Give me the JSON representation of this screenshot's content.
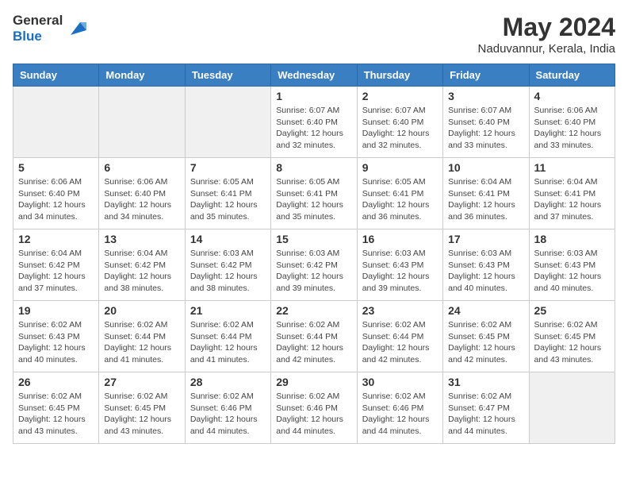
{
  "header": {
    "logo_line1": "General",
    "logo_line2": "Blue",
    "month_year": "May 2024",
    "location": "Naduvannur, Kerala, India"
  },
  "weekdays": [
    "Sunday",
    "Monday",
    "Tuesday",
    "Wednesday",
    "Thursday",
    "Friday",
    "Saturday"
  ],
  "weeks": [
    [
      {
        "day": "",
        "info": ""
      },
      {
        "day": "",
        "info": ""
      },
      {
        "day": "",
        "info": ""
      },
      {
        "day": "1",
        "info": "Sunrise: 6:07 AM\nSunset: 6:40 PM\nDaylight: 12 hours\nand 32 minutes."
      },
      {
        "day": "2",
        "info": "Sunrise: 6:07 AM\nSunset: 6:40 PM\nDaylight: 12 hours\nand 32 minutes."
      },
      {
        "day": "3",
        "info": "Sunrise: 6:07 AM\nSunset: 6:40 PM\nDaylight: 12 hours\nand 33 minutes."
      },
      {
        "day": "4",
        "info": "Sunrise: 6:06 AM\nSunset: 6:40 PM\nDaylight: 12 hours\nand 33 minutes."
      }
    ],
    [
      {
        "day": "5",
        "info": "Sunrise: 6:06 AM\nSunset: 6:40 PM\nDaylight: 12 hours\nand 34 minutes."
      },
      {
        "day": "6",
        "info": "Sunrise: 6:06 AM\nSunset: 6:40 PM\nDaylight: 12 hours\nand 34 minutes."
      },
      {
        "day": "7",
        "info": "Sunrise: 6:05 AM\nSunset: 6:41 PM\nDaylight: 12 hours\nand 35 minutes."
      },
      {
        "day": "8",
        "info": "Sunrise: 6:05 AM\nSunset: 6:41 PM\nDaylight: 12 hours\nand 35 minutes."
      },
      {
        "day": "9",
        "info": "Sunrise: 6:05 AM\nSunset: 6:41 PM\nDaylight: 12 hours\nand 36 minutes."
      },
      {
        "day": "10",
        "info": "Sunrise: 6:04 AM\nSunset: 6:41 PM\nDaylight: 12 hours\nand 36 minutes."
      },
      {
        "day": "11",
        "info": "Sunrise: 6:04 AM\nSunset: 6:41 PM\nDaylight: 12 hours\nand 37 minutes."
      }
    ],
    [
      {
        "day": "12",
        "info": "Sunrise: 6:04 AM\nSunset: 6:42 PM\nDaylight: 12 hours\nand 37 minutes."
      },
      {
        "day": "13",
        "info": "Sunrise: 6:04 AM\nSunset: 6:42 PM\nDaylight: 12 hours\nand 38 minutes."
      },
      {
        "day": "14",
        "info": "Sunrise: 6:03 AM\nSunset: 6:42 PM\nDaylight: 12 hours\nand 38 minutes."
      },
      {
        "day": "15",
        "info": "Sunrise: 6:03 AM\nSunset: 6:42 PM\nDaylight: 12 hours\nand 39 minutes."
      },
      {
        "day": "16",
        "info": "Sunrise: 6:03 AM\nSunset: 6:43 PM\nDaylight: 12 hours\nand 39 minutes."
      },
      {
        "day": "17",
        "info": "Sunrise: 6:03 AM\nSunset: 6:43 PM\nDaylight: 12 hours\nand 40 minutes."
      },
      {
        "day": "18",
        "info": "Sunrise: 6:03 AM\nSunset: 6:43 PM\nDaylight: 12 hours\nand 40 minutes."
      }
    ],
    [
      {
        "day": "19",
        "info": "Sunrise: 6:02 AM\nSunset: 6:43 PM\nDaylight: 12 hours\nand 40 minutes."
      },
      {
        "day": "20",
        "info": "Sunrise: 6:02 AM\nSunset: 6:44 PM\nDaylight: 12 hours\nand 41 minutes."
      },
      {
        "day": "21",
        "info": "Sunrise: 6:02 AM\nSunset: 6:44 PM\nDaylight: 12 hours\nand 41 minutes."
      },
      {
        "day": "22",
        "info": "Sunrise: 6:02 AM\nSunset: 6:44 PM\nDaylight: 12 hours\nand 42 minutes."
      },
      {
        "day": "23",
        "info": "Sunrise: 6:02 AM\nSunset: 6:44 PM\nDaylight: 12 hours\nand 42 minutes."
      },
      {
        "day": "24",
        "info": "Sunrise: 6:02 AM\nSunset: 6:45 PM\nDaylight: 12 hours\nand 42 minutes."
      },
      {
        "day": "25",
        "info": "Sunrise: 6:02 AM\nSunset: 6:45 PM\nDaylight: 12 hours\nand 43 minutes."
      }
    ],
    [
      {
        "day": "26",
        "info": "Sunrise: 6:02 AM\nSunset: 6:45 PM\nDaylight: 12 hours\nand 43 minutes."
      },
      {
        "day": "27",
        "info": "Sunrise: 6:02 AM\nSunset: 6:45 PM\nDaylight: 12 hours\nand 43 minutes."
      },
      {
        "day": "28",
        "info": "Sunrise: 6:02 AM\nSunset: 6:46 PM\nDaylight: 12 hours\nand 44 minutes."
      },
      {
        "day": "29",
        "info": "Sunrise: 6:02 AM\nSunset: 6:46 PM\nDaylight: 12 hours\nand 44 minutes."
      },
      {
        "day": "30",
        "info": "Sunrise: 6:02 AM\nSunset: 6:46 PM\nDaylight: 12 hours\nand 44 minutes."
      },
      {
        "day": "31",
        "info": "Sunrise: 6:02 AM\nSunset: 6:47 PM\nDaylight: 12 hours\nand 44 minutes."
      },
      {
        "day": "",
        "info": ""
      }
    ]
  ]
}
